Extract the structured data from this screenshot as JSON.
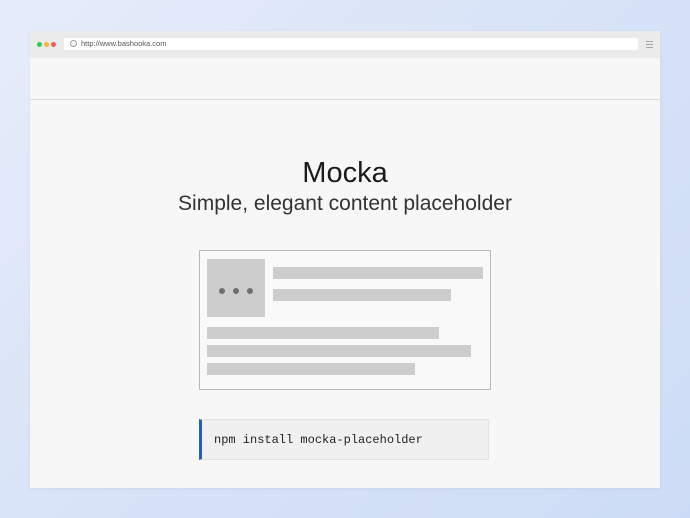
{
  "browser": {
    "url": "http://www.bashooka.com",
    "traffic_light_colors": [
      "#2ec95c",
      "#f2b72d",
      "#f25b57"
    ],
    "icons": [
      "page-icon",
      "menu-icon"
    ]
  },
  "hero": {
    "title": "Mocka",
    "subtitle": "Simple, elegant content placeholder"
  },
  "placeholder_card": {
    "thumbnail_icon": "ellipsis-icon",
    "line_count": 5,
    "placeholder_color": "#cdcdcd"
  },
  "install": {
    "command": "npm install mocka-placeholder",
    "accent_color": "#1f61b3"
  }
}
